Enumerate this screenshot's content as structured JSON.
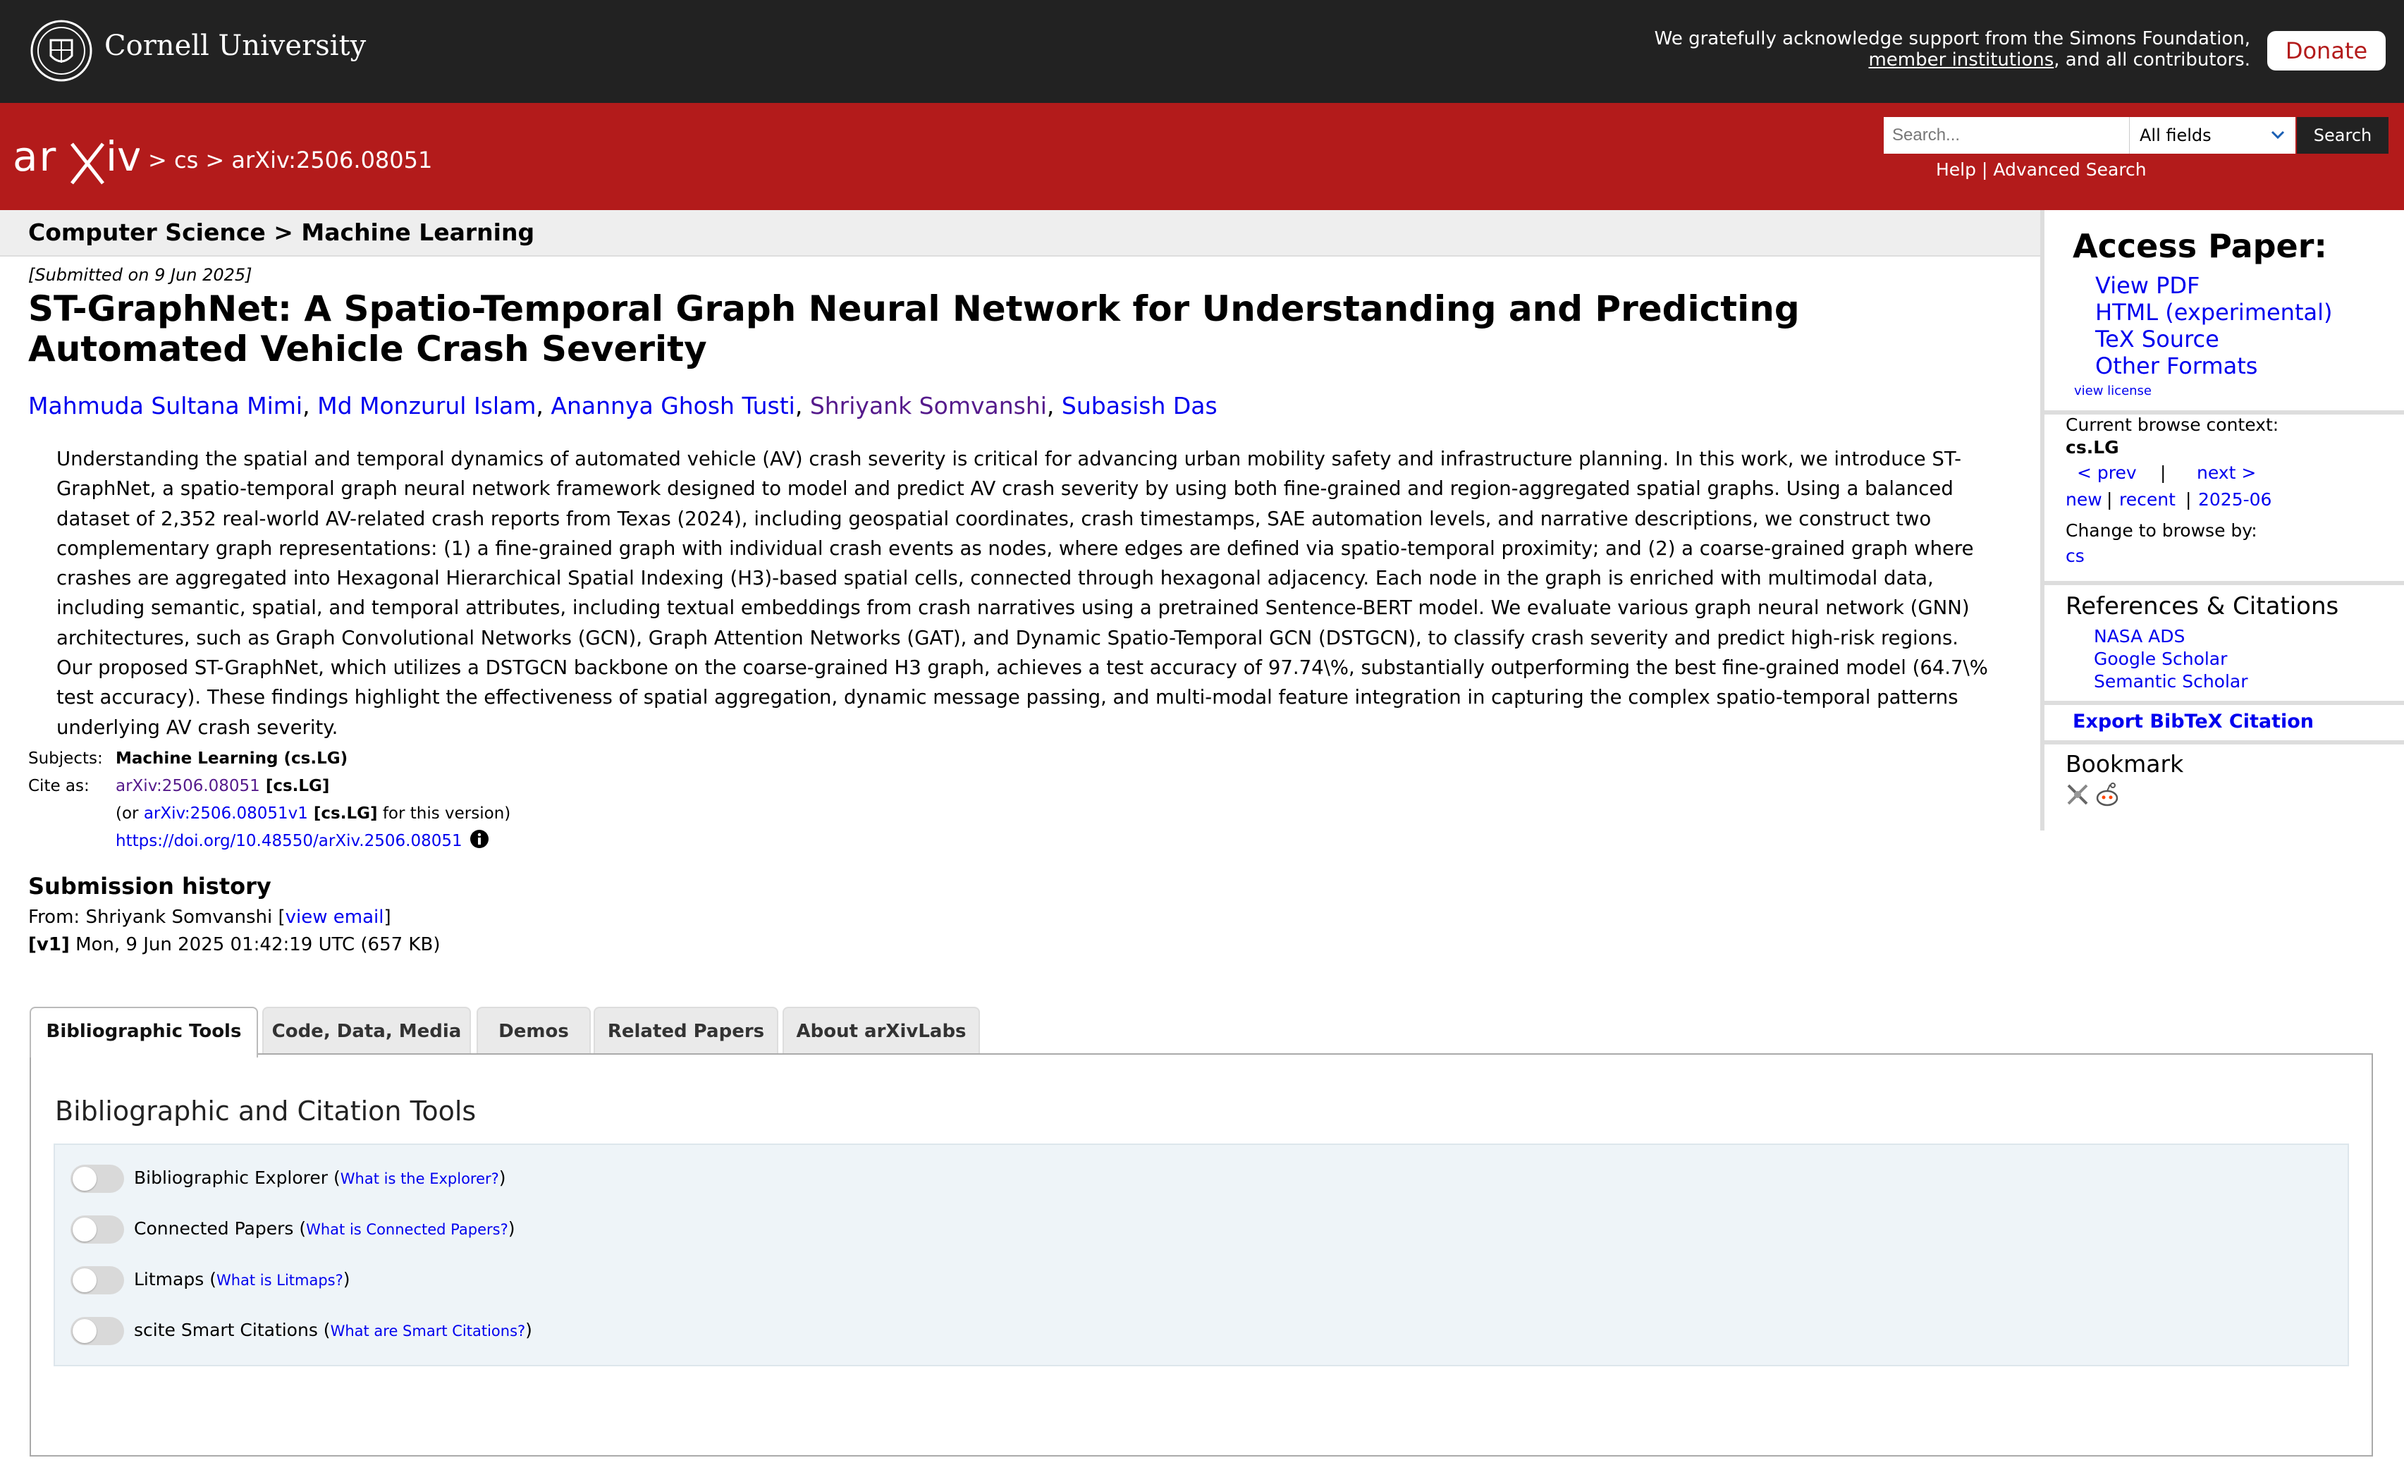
{
  "topbar": {
    "institution": "Cornell University",
    "support_line1": "We gratefully acknowledge support from the Simons Foundation,",
    "support_link": "member institutions",
    "support_line2_rest": ", and all contributors.",
    "donate_label": "Donate"
  },
  "header": {
    "logo_text": "arXiv",
    "breadcrumb": "> cs > arXiv:2506.08051",
    "search_placeholder": "Search...",
    "search_field": "All fields",
    "search_button": "Search",
    "help_label": "Help",
    "help_separator": " | ",
    "advanced_label": "Advanced Search"
  },
  "paper": {
    "subject_bar": "Computer Science > Machine Learning",
    "submitted": "[Submitted on 9 Jun 2025]",
    "title": "ST-GraphNet: A Spatio-Temporal Graph Neural Network for Understanding and Predicting Automated Vehicle Crash Severity",
    "authors": [
      {
        "name": "Mahmuda Sultana Mimi",
        "visited": false
      },
      {
        "name": "Md Monzurul Islam",
        "visited": false
      },
      {
        "name": "Anannya Ghosh Tusti",
        "visited": false
      },
      {
        "name": "Shriyank Somvanshi",
        "visited": true
      },
      {
        "name": "Subasish Das",
        "visited": false
      }
    ],
    "abstract": "Understanding the spatial and temporal dynamics of automated vehicle (AV) crash severity is critical for advancing urban mobility safety and infrastructure planning. In this work, we introduce ST-GraphNet, a spatio-temporal graph neural network framework designed to model and predict AV crash severity by using both fine-grained and region-aggregated spatial graphs. Using a balanced dataset of 2,352 real-world AV-related crash reports from Texas (2024), including geospatial coordinates, crash timestamps, SAE automation levels, and narrative descriptions, we construct two complementary graph representations: (1) a fine-grained graph with individual crash events as nodes, where edges are defined via spatio-temporal proximity; and (2) a coarse-grained graph where crashes are aggregated into Hexagonal Hierarchical Spatial Indexing (H3)-based spatial cells, connected through hexagonal adjacency. Each node in the graph is enriched with multimodal data, including semantic, spatial, and temporal attributes, including textual embeddings from crash narratives using a pretrained Sentence-BERT model. We evaluate various graph neural network (GNN) architectures, such as Graph Convolutional Networks (GCN), Graph Attention Networks (GAT), and Dynamic Spatio-Temporal GCN (DSTGCN), to classify crash severity and predict high-risk regions. Our proposed ST-GraphNet, which utilizes a DSTGCN backbone on the coarse-grained H3 graph, achieves a test accuracy of 97.74\\%, substantially outperforming the best fine-grained model (64.7\\% test accuracy). These findings highlight the effectiveness of spatial aggregation, dynamic message passing, and multi-modal feature integration in capturing the complex spatio-temporal patterns underlying AV crash severity.",
    "subjects_label": "Subjects:",
    "subjects_value": "Machine Learning (cs.LG)",
    "cite_label": "Cite as:",
    "cite_id": "arXiv:2506.08051",
    "cite_cat": " [cs.LG]",
    "cite_or": "(or ",
    "cite_version_id": "arXiv:2506.08051v1",
    "cite_version_cat": " [cs.LG]",
    "cite_version_rest": " for this version)",
    "doi": "https://doi.org/10.48550/arXiv.2506.08051"
  },
  "history": {
    "title": "Submission history",
    "from_prefix": "From: Shriyank Somvanshi [",
    "view_email": "view email",
    "from_suffix": "]",
    "v1_label": "[v1]",
    "v1_text": " Mon, 9 Jun 2025 01:42:19 UTC (657 KB)"
  },
  "tabs": [
    {
      "label": "Bibliographic Tools",
      "active": true
    },
    {
      "label": "Code, Data, Media",
      "active": false
    },
    {
      "label": "Demos",
      "active": false
    },
    {
      "label": "Related Papers",
      "active": false
    },
    {
      "label": "About arXivLabs",
      "active": false
    }
  ],
  "tools": {
    "title": "Bibliographic and Citation Tools",
    "items": [
      {
        "label": "Bibliographic Explorer",
        "help": "What is the Explorer?",
        "enabled": false
      },
      {
        "label": "Connected Papers",
        "help": "What is Connected Papers?",
        "enabled": false
      },
      {
        "label": "Litmaps",
        "help": "What is Litmaps?",
        "enabled": false
      },
      {
        "label": "scite Smart Citations",
        "help": "What are Smart Citations?",
        "enabled": false
      }
    ]
  },
  "sidebar": {
    "access_title": "Access Paper:",
    "access_links": [
      "View PDF",
      "HTML (experimental)",
      "TeX Source",
      "Other Formats"
    ],
    "view_license": "view license",
    "browse_context_label": "Current browse context:",
    "browse_context": "cs.LG",
    "prev": "< prev",
    "nav_sep": "|",
    "next": "next >",
    "new": "new",
    "recent": "recent",
    "month": "2025-06",
    "change_label": "Change to browse by:",
    "change_cs": "cs",
    "refs_title": "References & Citations",
    "refs_links": [
      "NASA ADS",
      "Google Scholar",
      "Semantic Scholar"
    ],
    "bibtex": "Export BibTeX Citation",
    "bookmark_title": "Bookmark"
  },
  "colors": {
    "arxiv_red": "#b31b1b",
    "topbar": "#222222",
    "link": "#0000ee",
    "visited": "#551a8b"
  }
}
